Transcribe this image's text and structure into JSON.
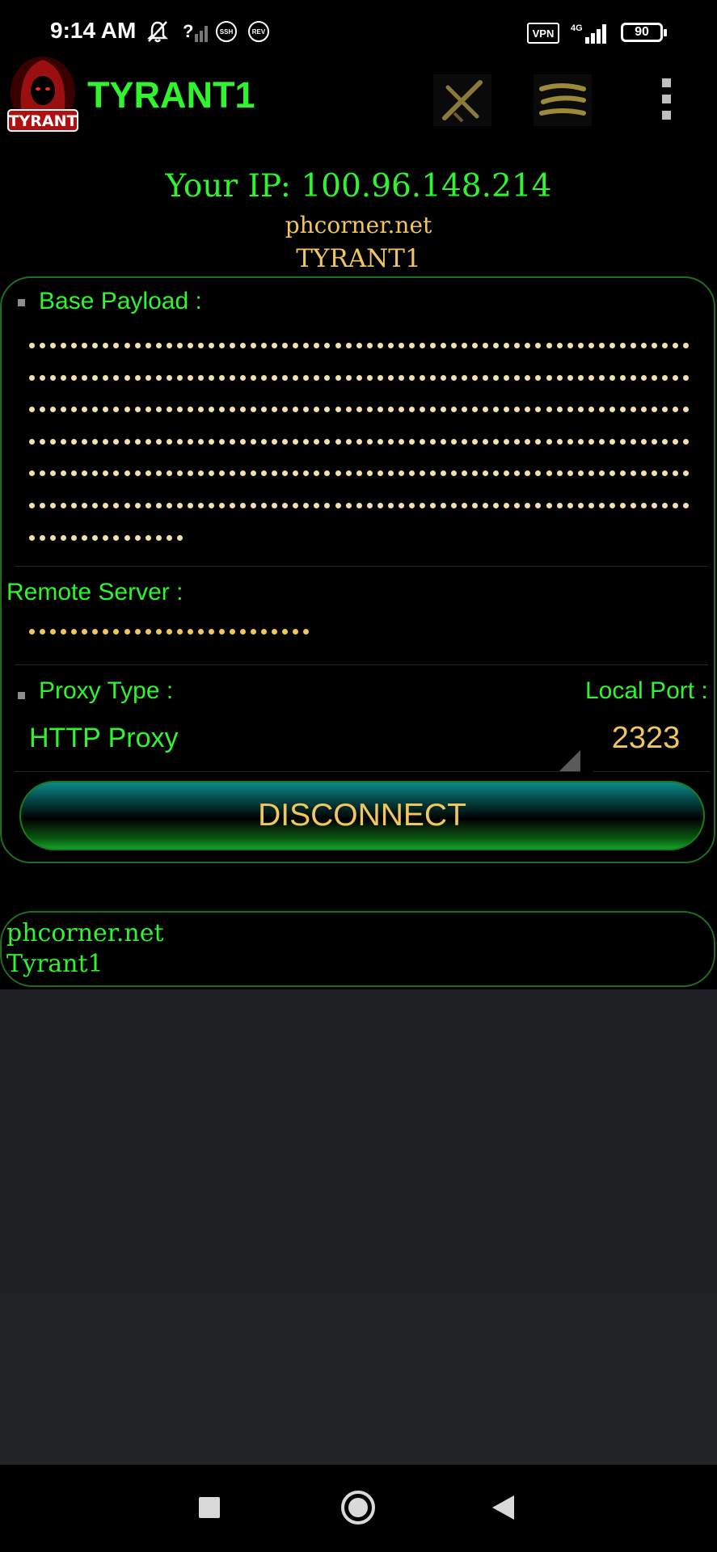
{
  "status_bar": {
    "time": "9:14 AM",
    "sim_mark": "?",
    "ssh_label": "SSH",
    "rev_label": "REV",
    "vpn_label": "VPN",
    "network_label": "4G",
    "battery_level": "90"
  },
  "app_bar": {
    "logo_text": "TYRANT",
    "title": "TYRANT1"
  },
  "header": {
    "ip_text": "Your IP: 100.96.148.214",
    "site": "phcorner.net",
    "name": "TYRANT1"
  },
  "config": {
    "payload_label": "Base Payload :",
    "payload_masked_lines": [
      63,
      63,
      63,
      63,
      63,
      63,
      15
    ],
    "remote_label": "Remote Server :",
    "remote_masked_length": 27,
    "proxy_label": "Proxy Type :",
    "proxy_value": "HTTP Proxy",
    "port_label": "Local Port :",
    "port_value": "2323"
  },
  "action": {
    "disconnect_label": "DISCONNECT"
  },
  "log": {
    "line1": "phcorner.net",
    "line2": "Tyrant1"
  },
  "colors": {
    "accent_green": "#2ef52e",
    "text_gold": "#f0c65d",
    "border_green": "#1f6e1f"
  }
}
